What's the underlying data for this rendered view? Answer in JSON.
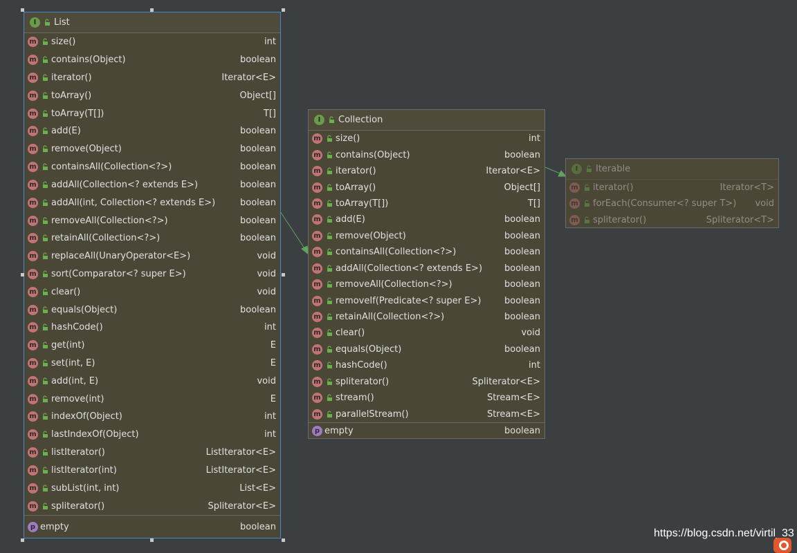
{
  "interfaces": {
    "list": {
      "kind_icon": "interface-icon",
      "title": "List",
      "methods": [
        {
          "name": "size()",
          "type": "int"
        },
        {
          "name": "contains(Object)",
          "type": "boolean"
        },
        {
          "name": "iterator()",
          "type": "Iterator<E>"
        },
        {
          "name": "toArray()",
          "type": "Object[]"
        },
        {
          "name": "toArray(T[])",
          "type": "T[]"
        },
        {
          "name": "add(E)",
          "type": "boolean"
        },
        {
          "name": "remove(Object)",
          "type": "boolean"
        },
        {
          "name": "containsAll(Collection<?>)",
          "type": "boolean"
        },
        {
          "name": "addAll(Collection<? extends E>)",
          "type": "boolean"
        },
        {
          "name": "addAll(int, Collection<? extends E>)",
          "type": "boolean"
        },
        {
          "name": "removeAll(Collection<?>)",
          "type": "boolean"
        },
        {
          "name": "retainAll(Collection<?>)",
          "type": "boolean"
        },
        {
          "name": "replaceAll(UnaryOperator<E>)",
          "type": "void"
        },
        {
          "name": "sort(Comparator<? super E>)",
          "type": "void"
        },
        {
          "name": "clear()",
          "type": "void"
        },
        {
          "name": "equals(Object)",
          "type": "boolean"
        },
        {
          "name": "hashCode()",
          "type": "int"
        },
        {
          "name": "get(int)",
          "type": "E"
        },
        {
          "name": "set(int, E)",
          "type": "E"
        },
        {
          "name": "add(int, E)",
          "type": "void"
        },
        {
          "name": "remove(int)",
          "type": "E"
        },
        {
          "name": "indexOf(Object)",
          "type": "int"
        },
        {
          "name": "lastIndexOf(Object)",
          "type": "int"
        },
        {
          "name": "listIterator()",
          "type": "ListIterator<E>"
        },
        {
          "name": "listIterator(int)",
          "type": "ListIterator<E>"
        },
        {
          "name": "subList(int, int)",
          "type": "List<E>"
        },
        {
          "name": "spliterator()",
          "type": "Spliterator<E>"
        }
      ],
      "property": {
        "name": "empty",
        "type": "boolean"
      }
    },
    "collection": {
      "kind_icon": "interface-icon",
      "title": "Collection",
      "methods": [
        {
          "name": "size()",
          "type": "int"
        },
        {
          "name": "contains(Object)",
          "type": "boolean"
        },
        {
          "name": "iterator()",
          "type": "Iterator<E>"
        },
        {
          "name": "toArray()",
          "type": "Object[]"
        },
        {
          "name": "toArray(T[])",
          "type": "T[]"
        },
        {
          "name": "add(E)",
          "type": "boolean"
        },
        {
          "name": "remove(Object)",
          "type": "boolean"
        },
        {
          "name": "containsAll(Collection<?>)",
          "type": "boolean"
        },
        {
          "name": "addAll(Collection<? extends E>)",
          "type": "boolean"
        },
        {
          "name": "removeAll(Collection<?>)",
          "type": "boolean"
        },
        {
          "name": "removeIf(Predicate<? super E>)",
          "type": "boolean"
        },
        {
          "name": "retainAll(Collection<?>)",
          "type": "boolean"
        },
        {
          "name": "clear()",
          "type": "void"
        },
        {
          "name": "equals(Object)",
          "type": "boolean"
        },
        {
          "name": "hashCode()",
          "type": "int"
        },
        {
          "name": "spliterator()",
          "type": "Spliterator<E>"
        },
        {
          "name": "stream()",
          "type": "Stream<E>"
        },
        {
          "name": "parallelStream()",
          "type": "Stream<E>"
        }
      ],
      "property": {
        "name": "empty",
        "type": "boolean"
      }
    },
    "iterable": {
      "kind_icon": "interface-icon",
      "title": "Iterable",
      "methods": [
        {
          "name": "iterator()",
          "type": "Iterator<T>"
        },
        {
          "name": "forEach(Consumer<? super T>)",
          "type": "void"
        },
        {
          "name": "spliterator()",
          "type": "Spliterator<T>"
        }
      ]
    }
  },
  "icons": {
    "method": "m",
    "interface": "I",
    "property": "p"
  },
  "colors": {
    "background": "#3c3f41",
    "node": "#4b4737",
    "arrow": "#5fa35f",
    "selection": "#4a88c7"
  },
  "watermark": "https://blog.csdn.net/virtil_33"
}
